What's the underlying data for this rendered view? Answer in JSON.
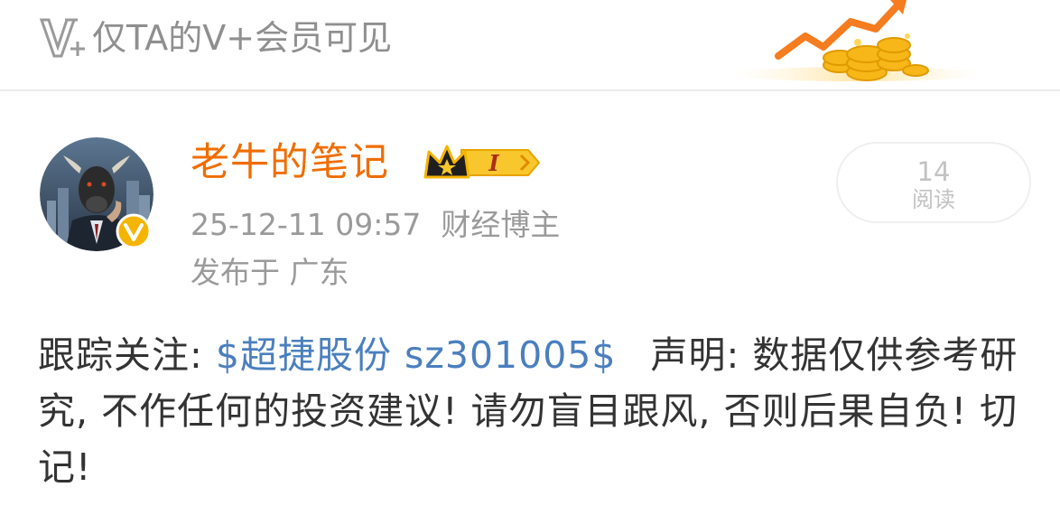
{
  "banner": {
    "logo_icon": "vplus-logo-icon",
    "text": "仅TA的V+会员可见",
    "art_icon": "growth-arrow-coins-icon"
  },
  "post": {
    "author": {
      "name": "老牛的笔记",
      "avatar_icon": "bull-businessman-avatar",
      "verified_icon": "verified-v-badge-icon",
      "badge_icon": "crown-level-badge-icon",
      "badge_level": "I"
    },
    "timestamp": "25-12-11 09:57",
    "author_tag": "财经博主",
    "location": "发布于 广东",
    "read_count": {
      "number": "14",
      "label": "阅读"
    },
    "content": {
      "prefix": "跟踪关注: ",
      "stock_link": "$超捷股份 sz301005$",
      "suffix": "声明: 数据仅供参考研究, 不作任何的投资建议! 请勿盲目跟风, 否则后果自负! 切记!"
    }
  },
  "colors": {
    "username": "#f06d00",
    "link": "#4a7fbe",
    "meta": "#9a9a9a",
    "banner_text": "#8f8f8f",
    "badge_gold": "#f5b400"
  }
}
